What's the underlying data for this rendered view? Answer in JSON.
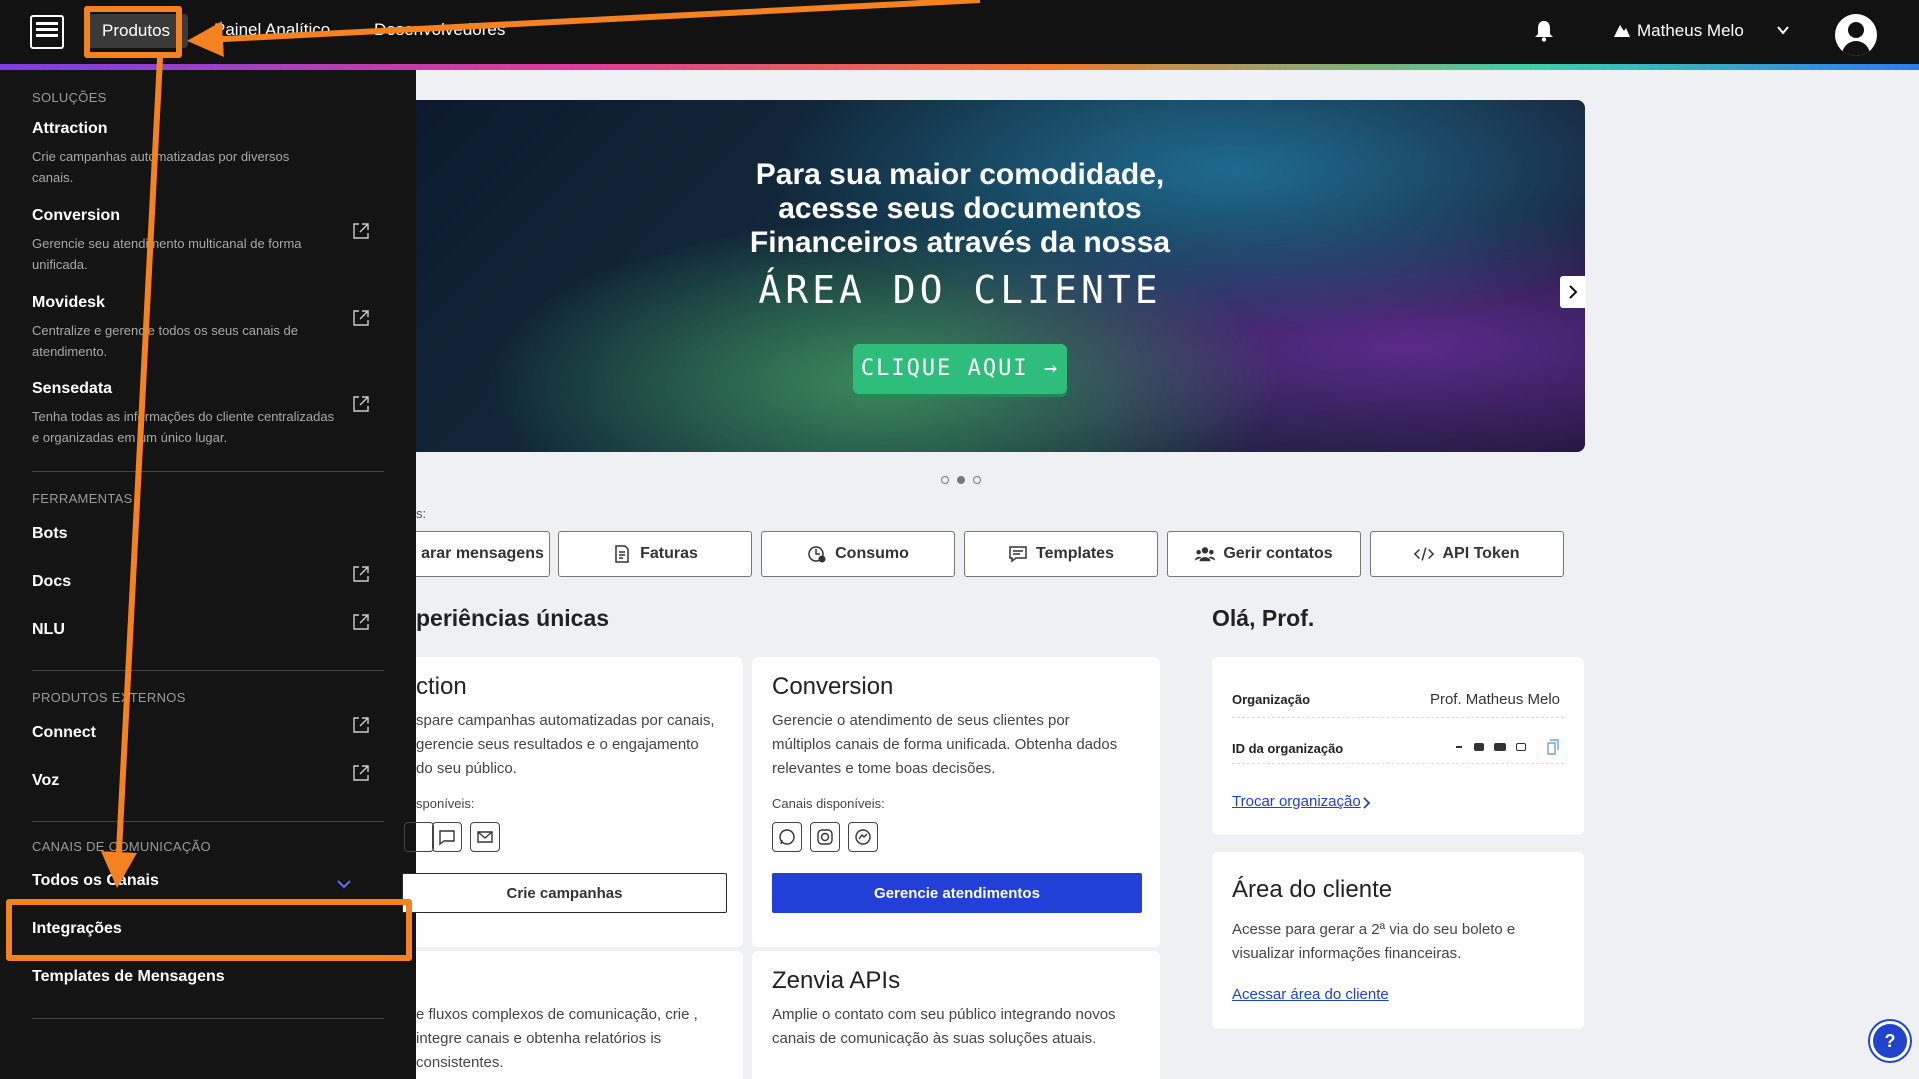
{
  "topbar": {
    "nav": [
      "Produtos",
      "Painel Analítico",
      "Desenvolvedores"
    ],
    "user_name": "Matheus Melo"
  },
  "sidebar": {
    "sections": [
      {
        "label": "SOLUÇÕES"
      },
      {
        "label": "FERRAMENTAS"
      },
      {
        "label": "PRODUTOS EXTERNOS"
      },
      {
        "label": "CANAIS DE COMUNICAÇÃO"
      }
    ],
    "solutions": [
      {
        "title": "Attraction",
        "desc": "Crie campanhas automatizadas por diversos canais."
      },
      {
        "title": "Conversion",
        "desc": "Gerencie seu atendimento multicanal de forma unificada."
      },
      {
        "title": "Movidesk",
        "desc": "Centralize e gerencie todos os seus canais de atendimento."
      },
      {
        "title": "Sensedata",
        "desc": "Tenha todas as informações do cliente centralizadas e organizadas em um único lugar."
      }
    ],
    "tools": [
      "Bots",
      "Docs",
      "NLU"
    ],
    "external": [
      "Connect",
      "Voz"
    ],
    "channels": [
      "Todos os Canais",
      "Integrações",
      "Templates de Mensagens"
    ]
  },
  "banner": {
    "line1": "Para sua maior comodidade,",
    "line2": "acesse seus documentos",
    "line3": "Financeiros através da nossa",
    "line4": "ÁREA DO CLIENTE",
    "cta": "CLIQUE AQUI →"
  },
  "quick": {
    "label": "s:",
    "buttons": [
      "arar mensagens",
      "Faturas",
      "Consumo",
      "Templates",
      "Gerir contatos",
      "API Token"
    ]
  },
  "main": {
    "heading": "periências únicas",
    "cards": [
      {
        "title": "ction",
        "desc": "spare campanhas automatizadas por canais, gerencie seus resultados e o engajamento do seu público.",
        "channels_label": "sponíveis:",
        "button": "Crie campanhas"
      },
      {
        "title": "Conversion",
        "desc": "Gerencie o atendimento de seus clientes por múltiplos canais de forma unificada. Obtenha dados relevantes e tome boas decisões.",
        "channels_label": "Canais disponíveis:",
        "button": "Gerencie atendimentos"
      },
      {
        "title": "",
        "desc": "e fluxos complexos de comunicação, crie , integre canais e obtenha relatórios is consistentes."
      },
      {
        "title": "Zenvia APIs",
        "desc": "Amplie o contato com seu público integrando novos canais de comunicação às suas soluções atuais."
      }
    ]
  },
  "profile": {
    "greeting": "Olá, Prof.",
    "org_label": "Organização",
    "org_value": "Prof. Matheus Melo",
    "id_label": "ID da organização",
    "switch_org": "Trocar organização"
  },
  "client_area": {
    "title": "Área do cliente",
    "desc": "Acesse para gerar a 2ª via do seu boleto e visualizar informações financeiras.",
    "link": "Acessar área do cliente"
  },
  "help": {
    "label": "?"
  },
  "colors": {
    "accent": "#f58220",
    "primary_button": "#2240d8",
    "cta": "#2ebd7a"
  }
}
